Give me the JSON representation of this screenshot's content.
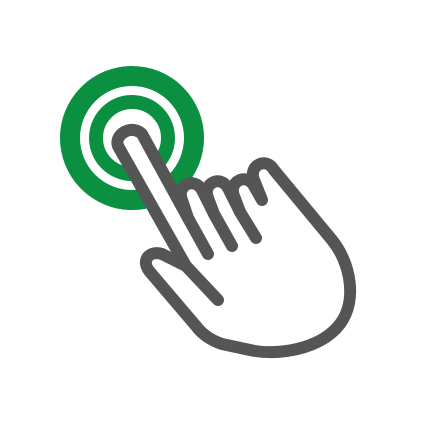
{
  "icon": {
    "name": "tap-gesture-icon",
    "colors": {
      "ripple": "#0a9040",
      "hand_stroke": "#555555",
      "hand_fill": "#ffffff",
      "background": "#ffffff"
    }
  }
}
